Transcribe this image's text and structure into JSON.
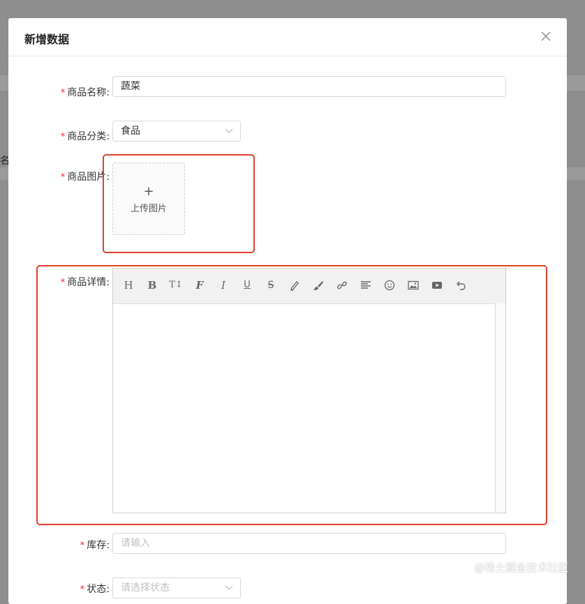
{
  "background": {
    "partial_label": "名"
  },
  "modal": {
    "title": "新增数据",
    "close_label": "X"
  },
  "form": {
    "required_mark": "*",
    "name": {
      "label": "商品名称:",
      "value": "蔬菜"
    },
    "category": {
      "label": "商品分类:",
      "value": "食品"
    },
    "image": {
      "label": "商品图片:",
      "upload_plus": "+",
      "upload_text": "上传图片"
    },
    "detail": {
      "label": "商品详情:",
      "content": ""
    },
    "stock": {
      "label": "库存:",
      "placeholder": "请输入"
    },
    "status": {
      "label": "状态:",
      "placeholder": "请选择状态"
    }
  },
  "toolbar": {
    "heading_label": "H",
    "bold_label": "B",
    "fontsize_label": "T↕",
    "font_label": "F",
    "italic_label": "I",
    "underline_label": "U",
    "strike_label": "S",
    "icons": [
      "heading-icon",
      "bold-icon",
      "font-size-icon",
      "font-family-icon",
      "italic-icon",
      "underline-icon",
      "strikethrough-icon",
      "text-color-icon",
      "background-color-icon",
      "link-icon",
      "align-icon",
      "emoticon-icon",
      "image-icon",
      "video-icon",
      "undo-icon"
    ]
  },
  "highlight_color": "#e0402a",
  "watermark": "@稀土掘金技术社区"
}
